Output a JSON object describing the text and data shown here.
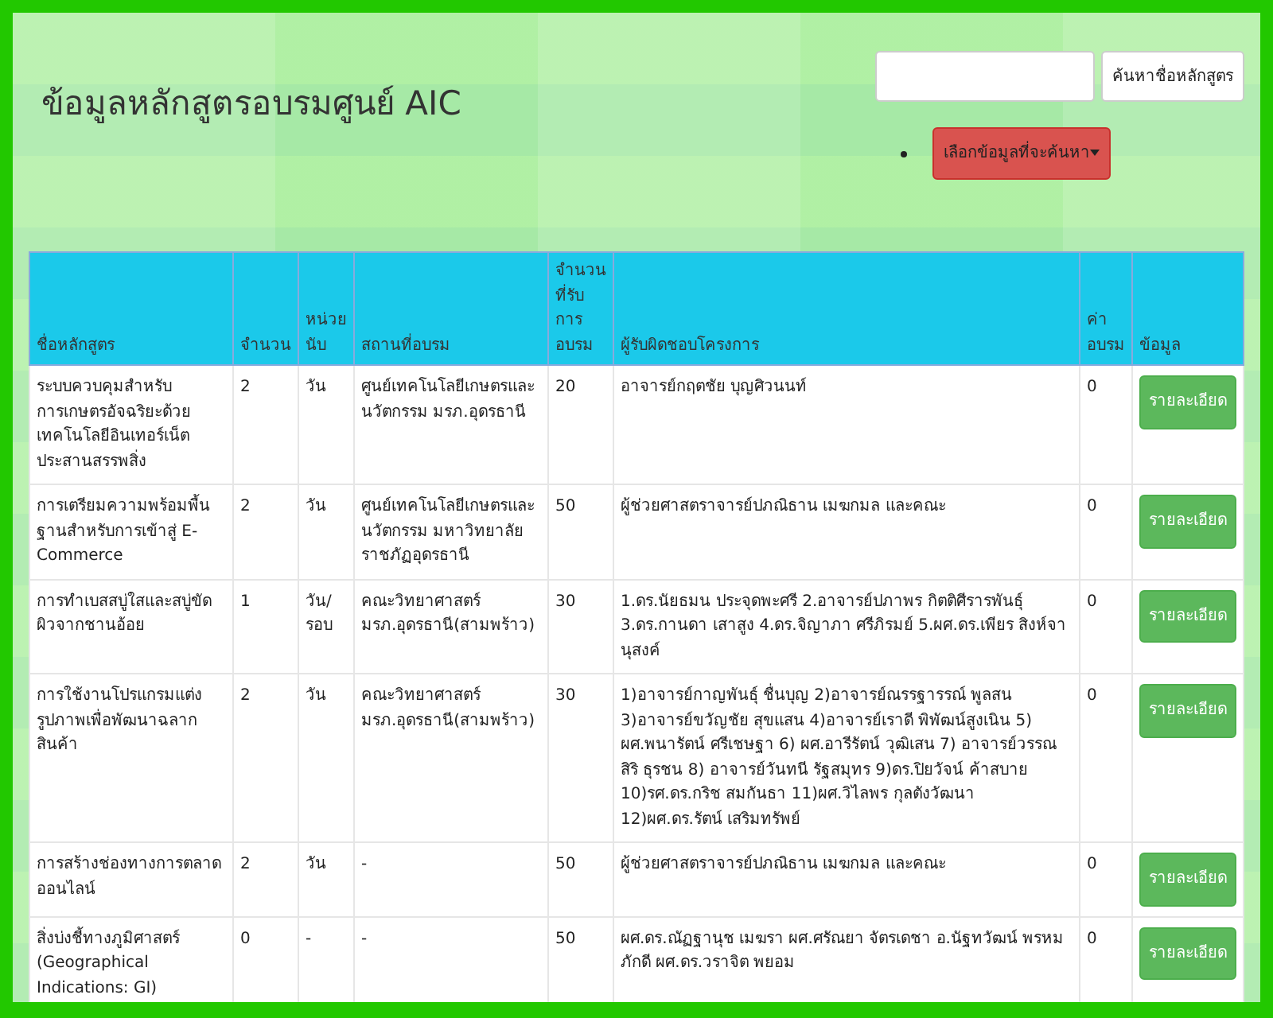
{
  "title": "ข้อมูลหลักสูตรอบรมศูนย์ AIC",
  "search": {
    "button": "ค้นหาชื่อหลักสูตร"
  },
  "filter_button": "เลือกข้อมูลที่จะค้นหา",
  "table": {
    "columns": [
      "ชื่อหลักสูตร",
      "จำนวน",
      "หน่วยนับ",
      "สถานที่อบรม",
      "จำนวนที่รับการอบรม",
      "ผู้รับผิดชอบโครงการ",
      "ค่าอบรม",
      "ข้อมูล"
    ],
    "rows": [
      {
        "cells": [
          "ระบบควบคุมสำหรับการเกษตรอัจฉริยะด้วยเทคโนโลยีอินเทอร์เน็ตประสานสรรพสิ่ง",
          "2",
          "วัน",
          "ศูนย์เทคโนโลยีเกษตรและนวัตกรรม มรภ.อุดรธานี",
          "20",
          "อาจารย์กฤตชัย บุญศิวนนท์",
          "0"
        ],
        "button": "รายละเอียด"
      },
      {
        "cells": [
          "การเตรียมความพร้อมพื้นฐานสำหรับการเข้าสู่ E-Commerce",
          "2",
          "วัน",
          "ศูนย์เทคโนโลยีเกษตรและนวัตกรรม มหาวิทยาลัยราชภัฏอุดรธานี",
          "50",
          "ผู้ช่วยศาสตราจารย์ปภณิธาน เมฆกมล และคณะ",
          "0"
        ],
        "button": "รายละเอียด"
      },
      {
        "cells": [
          "การทำเบสสบู่ใสและสบู่ขัดผิวจากชานอ้อย",
          "1",
          "วัน/รอบ",
          "คณะวิทยาศาสตร์ มรภ.อุดรธานี(สามพร้าว)",
          "30",
          "1.ดร.นัยธมน ประจุดพะศรี 2.อาจารย์ปภาพร กิตติศีรารพันธุ์ 3.ดร.กานดา เสาสูง 4.ดร.จิญาภา ศรีภิรมย์ 5.ผศ.ดร.เพียร สิงห์จานุสงค์",
          "0"
        ],
        "button": "รายละเอียด"
      },
      {
        "cells": [
          "การใช้งานโปรแกรมแต่งรูปภาพเพื่อพัฒนาฉลากสินค้า",
          "2",
          "วัน",
          "คณะวิทยาศาสตร์ มรภ.อุดรธานี(สามพร้าว)",
          "30",
          "1)อาจารย์กาญพันธุ์ ชื่นบุญ 2)อาจารย์ณรรฐารรณ์ พูลสน 3)อาจารย์ขวัญชัย สุขแสน 4)อาจารย์เราดี พิพัฒน์สูงเนิน 5) ผศ.พนารัตน์ ศรีเชษฐา 6) ผศ.อารีรัตน์ วุฒิเสน 7) อาจารย์วรรณสิริ ธุรชน 8) อาจารย์วันทนี รัฐสมุทร 9)ดร.ปิยวัจน์ ค้าสบาย 10)รศ.ดร.กริช สมกันธา 11)ผศ.วิไลพร กุลตังวัฒนา 12)ผศ.ดร.รัตน์ เสริมทรัพย์",
          "0"
        ],
        "button": "รายละเอียด"
      },
      {
        "cells": [
          "การสร้างช่องทางการตลาดออนไลน์",
          "2",
          "วัน",
          "-",
          "50",
          "ผู้ช่วยศาสตราจารย์ปภณิธาน เมฆกมล และคณะ",
          "0"
        ],
        "button": "รายละเอียด"
      },
      {
        "cells": [
          "สิ่งบ่งชี้ทางภูมิศาสตร์ (Geographical Indications: GI)",
          "0",
          "-",
          "-",
          "50",
          "ผศ.ดร.ณัฏฐานุช เมฆรา ผศ.ศรัณยา จัตรเดชา อ.นัฐทวัฒน์ พรหมภักดี ผศ.ดร.วราจิต พยอม",
          "0"
        ],
        "button": "รายละเอียด"
      }
    ]
  }
}
